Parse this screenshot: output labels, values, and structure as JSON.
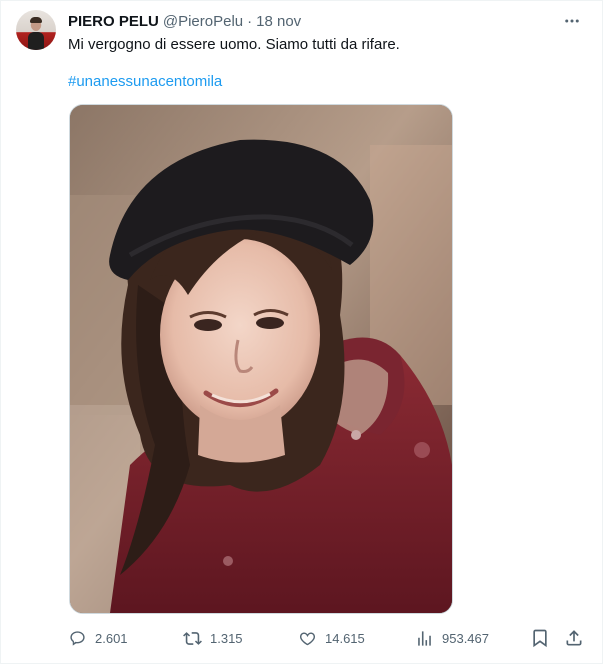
{
  "tweet": {
    "author_name": "PIERO PELU",
    "handle": "@PieroPelu",
    "separator": "·",
    "time": "18 nov",
    "text": "Mi vergogno di essere uomo. Siamo tutti da rifare.",
    "hashtag": "#unanessunacentomila"
  },
  "actions": {
    "replies": "2.601",
    "retweets": "1.315",
    "likes": "14.615",
    "views": "953.467"
  },
  "icons": {
    "more": "more-horizontal-icon",
    "reply": "reply-icon",
    "retweet": "retweet-icon",
    "like": "heart-icon",
    "views": "views-chart-icon",
    "bookmark": "bookmark-icon",
    "share": "share-icon"
  },
  "colors": {
    "link": "#1d9bf0",
    "secondary_text": "#536471",
    "primary_text": "#0f1419"
  }
}
